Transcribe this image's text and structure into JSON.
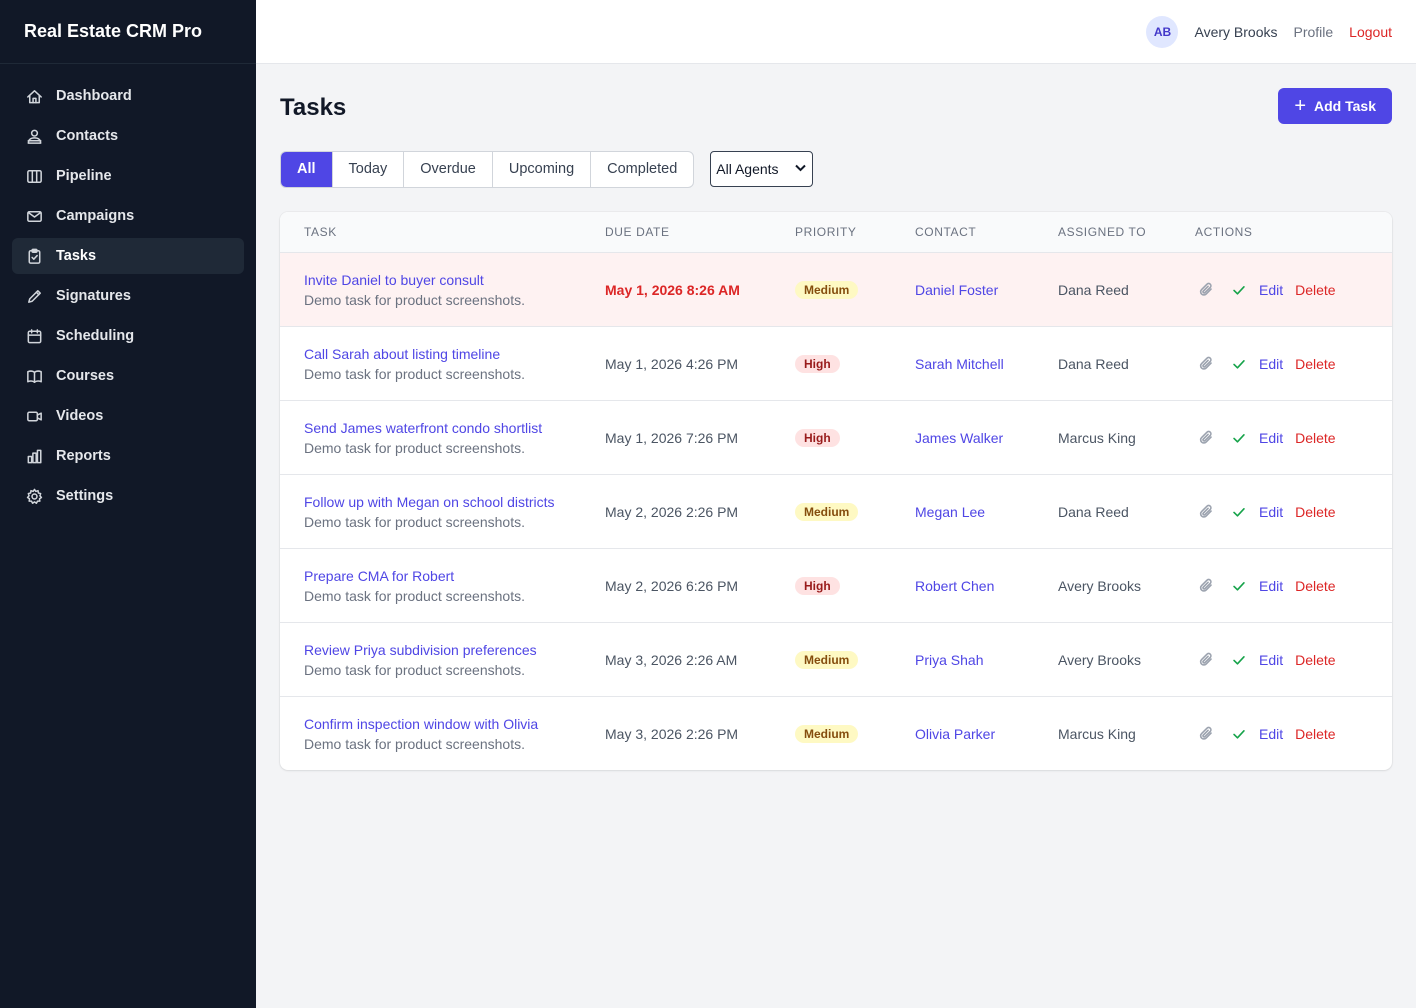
{
  "app": {
    "brand": "Real Estate CRM Pro"
  },
  "sidebar": {
    "items": [
      {
        "label": "Dashboard",
        "icon": "home-icon"
      },
      {
        "label": "Contacts",
        "icon": "users-icon"
      },
      {
        "label": "Pipeline",
        "icon": "columns-icon"
      },
      {
        "label": "Campaigns",
        "icon": "mail-icon"
      },
      {
        "label": "Tasks",
        "icon": "clipboard-check-icon",
        "active": true
      },
      {
        "label": "Signatures",
        "icon": "pen-icon"
      },
      {
        "label": "Scheduling",
        "icon": "calendar-icon"
      },
      {
        "label": "Courses",
        "icon": "book-icon"
      },
      {
        "label": "Videos",
        "icon": "video-icon"
      },
      {
        "label": "Reports",
        "icon": "bar-chart-icon"
      },
      {
        "label": "Settings",
        "icon": "gear-icon"
      }
    ]
  },
  "topbar": {
    "avatar_initials": "AB",
    "user_name": "Avery Brooks",
    "profile_label": "Profile",
    "logout_label": "Logout"
  },
  "page": {
    "title": "Tasks",
    "add_button_label": "Add Task",
    "add_button_icon": "plus-icon"
  },
  "filters": {
    "tabs": [
      "All",
      "Today",
      "Overdue",
      "Upcoming",
      "Completed"
    ],
    "active_tab": "All",
    "agent_select": {
      "selected": "All Agents"
    }
  },
  "table": {
    "headers": {
      "task": "TASK",
      "due": "DUE DATE",
      "priority": "PRIORITY",
      "contact": "CONTACT",
      "assigned": "ASSIGNED TO",
      "actions": "ACTIONS"
    },
    "action_labels": {
      "edit": "Edit",
      "delete": "Delete"
    },
    "rows": [
      {
        "title": "Invite Daniel to buyer consult",
        "desc": "Demo task for product screenshots.",
        "due": "May 1, 2026 8:26 AM",
        "overdue": true,
        "priority": "Medium",
        "contact": "Daniel Foster",
        "assigned": "Dana Reed"
      },
      {
        "title": "Call Sarah about listing timeline",
        "desc": "Demo task for product screenshots.",
        "due": "May 1, 2026 4:26 PM",
        "overdue": false,
        "priority": "High",
        "contact": "Sarah Mitchell",
        "assigned": "Dana Reed"
      },
      {
        "title": "Send James waterfront condo shortlist",
        "desc": "Demo task for product screenshots.",
        "due": "May 1, 2026 7:26 PM",
        "overdue": false,
        "priority": "High",
        "contact": "James Walker",
        "assigned": "Marcus King"
      },
      {
        "title": "Follow up with Megan on school districts",
        "desc": "Demo task for product screenshots.",
        "due": "May 2, 2026 2:26 PM",
        "overdue": false,
        "priority": "Medium",
        "contact": "Megan Lee",
        "assigned": "Dana Reed"
      },
      {
        "title": "Prepare CMA for Robert",
        "desc": "Demo task for product screenshots.",
        "due": "May 2, 2026 6:26 PM",
        "overdue": false,
        "priority": "High",
        "contact": "Robert Chen",
        "assigned": "Avery Brooks"
      },
      {
        "title": "Review Priya subdivision preferences",
        "desc": "Demo task for product screenshots.",
        "due": "May 3, 2026 2:26 AM",
        "overdue": false,
        "priority": "Medium",
        "contact": "Priya Shah",
        "assigned": "Avery Brooks"
      },
      {
        "title": "Confirm inspection window with Olivia",
        "desc": "Demo task for product screenshots.",
        "due": "May 3, 2026 2:26 PM",
        "overdue": false,
        "priority": "Medium",
        "contact": "Olivia Parker",
        "assigned": "Marcus King"
      }
    ]
  },
  "colors": {
    "sidebar_bg": "#111827",
    "accent": "#4f46e5",
    "danger": "#dc2626",
    "success": "#16a34a"
  }
}
